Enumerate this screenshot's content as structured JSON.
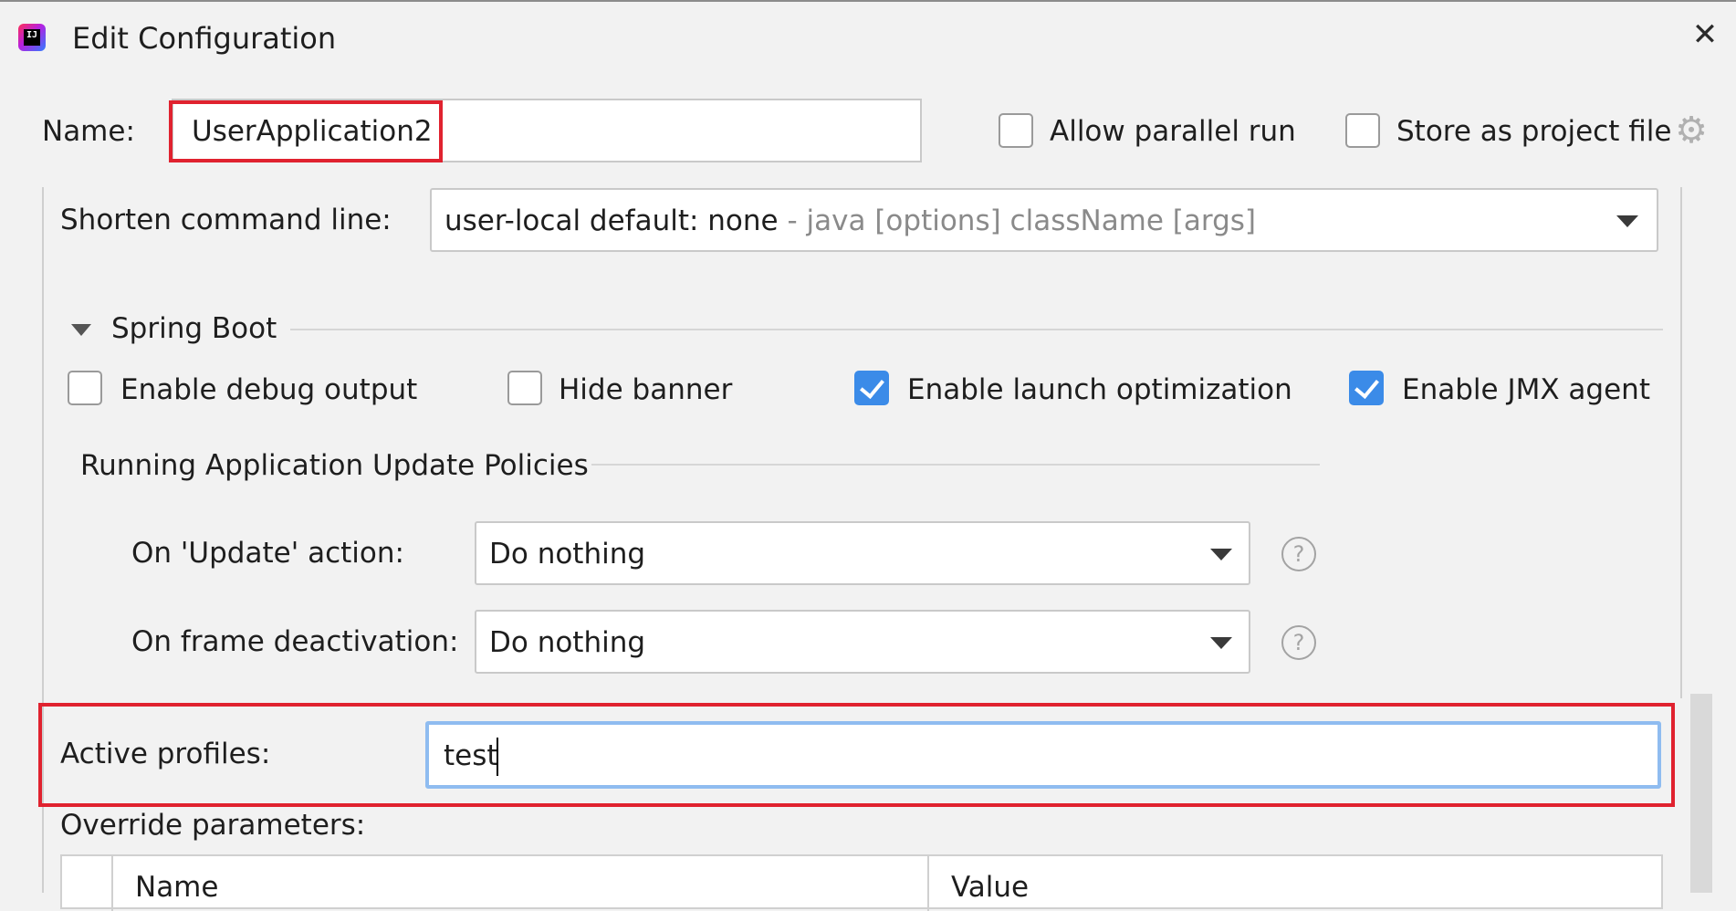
{
  "window": {
    "title": "Edit Configuration",
    "close_glyph": "✕"
  },
  "name_row": {
    "label": "Name:",
    "value": "UserApplication2",
    "allow_parallel_label": "Allow parallel run",
    "allow_parallel_checked": false,
    "store_project_label": "Store as project file",
    "store_project_checked": false,
    "gear_icon": "gear-icon"
  },
  "shorten": {
    "label": "Shorten command line:",
    "value": "user-local default: none",
    "hint": " - java [options] className [args]"
  },
  "spring_boot": {
    "section_title": "Spring Boot",
    "options": [
      {
        "label": "Enable debug output",
        "checked": false
      },
      {
        "label": "Hide banner",
        "checked": false
      },
      {
        "label": "Enable launch optimization",
        "checked": true
      },
      {
        "label": "Enable JMX agent",
        "checked": true
      }
    ]
  },
  "policies": {
    "section_title": "Running Application Update Policies",
    "update_label": "On 'Update' action:",
    "update_value": "Do nothing",
    "deactivation_label": "On frame deactivation:",
    "deactivation_value": "Do nothing",
    "help_glyph": "?"
  },
  "profiles": {
    "label": "Active profiles:",
    "value": "test"
  },
  "override": {
    "label": "Override parameters:",
    "columns": [
      "Name",
      "Value"
    ]
  },
  "colors": {
    "highlight_red": "#e0222f",
    "focus_blue": "#8fbcf0",
    "checkbox_blue": "#3b8be8"
  }
}
